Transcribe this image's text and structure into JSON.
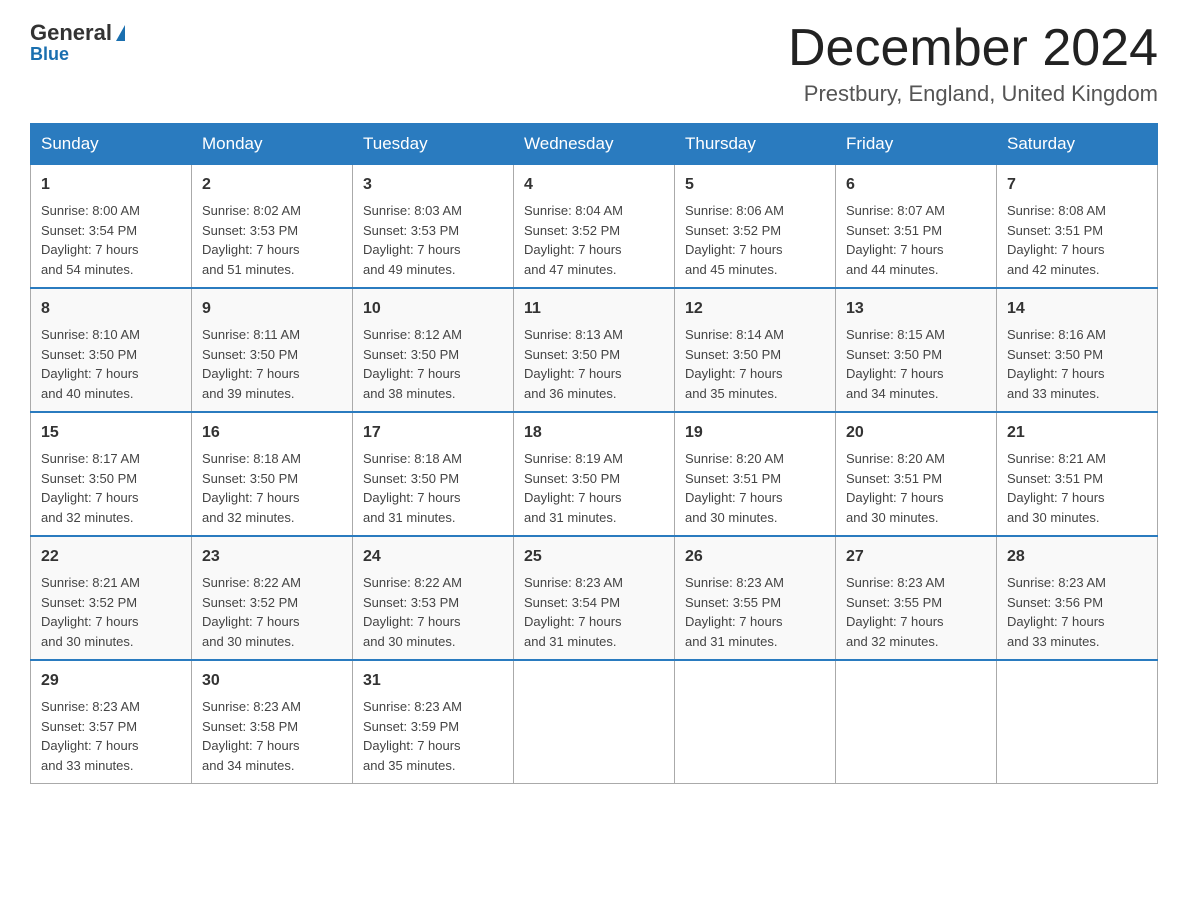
{
  "header": {
    "logo_general": "General",
    "logo_blue": "Blue",
    "month_title": "December 2024",
    "location": "Prestbury, England, United Kingdom"
  },
  "days_of_week": [
    "Sunday",
    "Monday",
    "Tuesday",
    "Wednesday",
    "Thursday",
    "Friday",
    "Saturday"
  ],
  "weeks": [
    [
      {
        "day": "1",
        "sunrise": "8:00 AM",
        "sunset": "3:54 PM",
        "daylight": "7 hours and 54 minutes."
      },
      {
        "day": "2",
        "sunrise": "8:02 AM",
        "sunset": "3:53 PM",
        "daylight": "7 hours and 51 minutes."
      },
      {
        "day": "3",
        "sunrise": "8:03 AM",
        "sunset": "3:53 PM",
        "daylight": "7 hours and 49 minutes."
      },
      {
        "day": "4",
        "sunrise": "8:04 AM",
        "sunset": "3:52 PM",
        "daylight": "7 hours and 47 minutes."
      },
      {
        "day": "5",
        "sunrise": "8:06 AM",
        "sunset": "3:52 PM",
        "daylight": "7 hours and 45 minutes."
      },
      {
        "day": "6",
        "sunrise": "8:07 AM",
        "sunset": "3:51 PM",
        "daylight": "7 hours and 44 minutes."
      },
      {
        "day": "7",
        "sunrise": "8:08 AM",
        "sunset": "3:51 PM",
        "daylight": "7 hours and 42 minutes."
      }
    ],
    [
      {
        "day": "8",
        "sunrise": "8:10 AM",
        "sunset": "3:50 PM",
        "daylight": "7 hours and 40 minutes."
      },
      {
        "day": "9",
        "sunrise": "8:11 AM",
        "sunset": "3:50 PM",
        "daylight": "7 hours and 39 minutes."
      },
      {
        "day": "10",
        "sunrise": "8:12 AM",
        "sunset": "3:50 PM",
        "daylight": "7 hours and 38 minutes."
      },
      {
        "day": "11",
        "sunrise": "8:13 AM",
        "sunset": "3:50 PM",
        "daylight": "7 hours and 36 minutes."
      },
      {
        "day": "12",
        "sunrise": "8:14 AM",
        "sunset": "3:50 PM",
        "daylight": "7 hours and 35 minutes."
      },
      {
        "day": "13",
        "sunrise": "8:15 AM",
        "sunset": "3:50 PM",
        "daylight": "7 hours and 34 minutes."
      },
      {
        "day": "14",
        "sunrise": "8:16 AM",
        "sunset": "3:50 PM",
        "daylight": "7 hours and 33 minutes."
      }
    ],
    [
      {
        "day": "15",
        "sunrise": "8:17 AM",
        "sunset": "3:50 PM",
        "daylight": "7 hours and 32 minutes."
      },
      {
        "day": "16",
        "sunrise": "8:18 AM",
        "sunset": "3:50 PM",
        "daylight": "7 hours and 32 minutes."
      },
      {
        "day": "17",
        "sunrise": "8:18 AM",
        "sunset": "3:50 PM",
        "daylight": "7 hours and 31 minutes."
      },
      {
        "day": "18",
        "sunrise": "8:19 AM",
        "sunset": "3:50 PM",
        "daylight": "7 hours and 31 minutes."
      },
      {
        "day": "19",
        "sunrise": "8:20 AM",
        "sunset": "3:51 PM",
        "daylight": "7 hours and 30 minutes."
      },
      {
        "day": "20",
        "sunrise": "8:20 AM",
        "sunset": "3:51 PM",
        "daylight": "7 hours and 30 minutes."
      },
      {
        "day": "21",
        "sunrise": "8:21 AM",
        "sunset": "3:51 PM",
        "daylight": "7 hours and 30 minutes."
      }
    ],
    [
      {
        "day": "22",
        "sunrise": "8:21 AM",
        "sunset": "3:52 PM",
        "daylight": "7 hours and 30 minutes."
      },
      {
        "day": "23",
        "sunrise": "8:22 AM",
        "sunset": "3:52 PM",
        "daylight": "7 hours and 30 minutes."
      },
      {
        "day": "24",
        "sunrise": "8:22 AM",
        "sunset": "3:53 PM",
        "daylight": "7 hours and 30 minutes."
      },
      {
        "day": "25",
        "sunrise": "8:23 AM",
        "sunset": "3:54 PM",
        "daylight": "7 hours and 31 minutes."
      },
      {
        "day": "26",
        "sunrise": "8:23 AM",
        "sunset": "3:55 PM",
        "daylight": "7 hours and 31 minutes."
      },
      {
        "day": "27",
        "sunrise": "8:23 AM",
        "sunset": "3:55 PM",
        "daylight": "7 hours and 32 minutes."
      },
      {
        "day": "28",
        "sunrise": "8:23 AM",
        "sunset": "3:56 PM",
        "daylight": "7 hours and 33 minutes."
      }
    ],
    [
      {
        "day": "29",
        "sunrise": "8:23 AM",
        "sunset": "3:57 PM",
        "daylight": "7 hours and 33 minutes."
      },
      {
        "day": "30",
        "sunrise": "8:23 AM",
        "sunset": "3:58 PM",
        "daylight": "7 hours and 34 minutes."
      },
      {
        "day": "31",
        "sunrise": "8:23 AM",
        "sunset": "3:59 PM",
        "daylight": "7 hours and 35 minutes."
      },
      null,
      null,
      null,
      null
    ]
  ],
  "labels": {
    "sunrise": "Sunrise:",
    "sunset": "Sunset:",
    "daylight": "Daylight:"
  }
}
